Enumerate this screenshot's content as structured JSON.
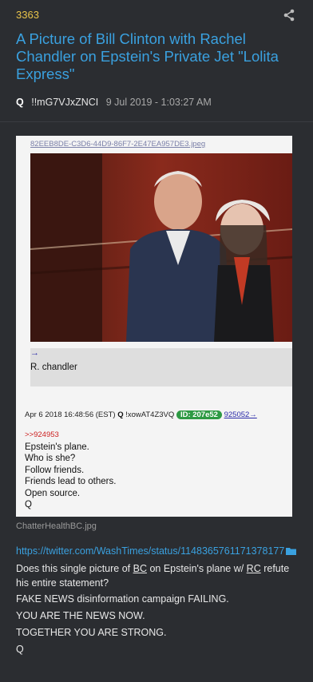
{
  "post": {
    "number": "3363",
    "title": "A Picture of Bill Clinton with Rachel Chandler on Epstein's Private Jet \"Lolita Express\"",
    "author": "Q",
    "tripcode": "!!mG7VJxZNCI",
    "date": "9 Jul 2019 - 1:03:27 AM"
  },
  "screenshot": {
    "filename": "82EEB8DE-C3D6-44D9-86F7-2E47EA957DE3.jpeg",
    "arrow": "→",
    "caption": "R. chandler",
    "header_date": "Apr 6 2018 16:48:56 (EST)",
    "header_author": "Q",
    "header_trip": "!xowAT4Z3VQ",
    "header_id": "ID: 207e52",
    "header_ref": "925052→",
    "reply_ref": ">>924953",
    "lines": [
      "Epstein's plane.",
      "Who is she?",
      "Follow friends.",
      "Friends lead to others.",
      "Open source.",
      "Q"
    ]
  },
  "image_name": "ChatterHealthBC.jpg",
  "link": "https://twitter.com/WashTimes/status/1148365761171378177",
  "message": {
    "line1_a": "Does this single picture of ",
    "bc": "BC",
    "line1_b": " on Epstein's plane w/ ",
    "rc": "RC",
    "line1_c": " refute his entire statement?",
    "line2": "FAKE NEWS disinformation campaign FAILING.",
    "line3": "YOU ARE THE NEWS NOW.",
    "line4": "TOGETHER YOU ARE STRONG.",
    "line5": "Q"
  },
  "icons": {
    "share": "share-icon",
    "folder": "folder-icon"
  },
  "colors": {
    "link": "#3aa1e0",
    "post_number": "#e8c34a",
    "id_badge": "#2e9a44"
  }
}
